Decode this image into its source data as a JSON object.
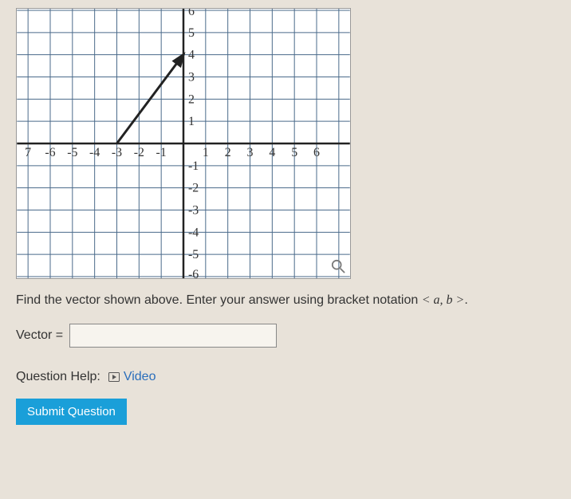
{
  "prompt_text_pre": "Find the vector shown above. Enter your answer using bracket notation ",
  "prompt_math": "< a, b >",
  "prompt_text_post": ".",
  "vector_label": "Vector =",
  "vector_value": "",
  "help_label": "Question Help:",
  "video_link_text": "Video",
  "submit_label": "Submit Question",
  "chart_data": {
    "type": "vector-plot",
    "x_ticks": [
      -7,
      -6,
      -5,
      -4,
      -3,
      -2,
      -1,
      1,
      2,
      3,
      4,
      5,
      6
    ],
    "y_ticks": [
      6,
      5,
      4,
      3,
      2,
      1,
      -1,
      -2,
      -3,
      -4,
      -5,
      -6
    ],
    "xlim": [
      -7,
      7
    ],
    "ylim": [
      -7,
      7
    ],
    "vector": {
      "tail": [
        -3,
        0
      ],
      "head": [
        0,
        4
      ]
    }
  }
}
